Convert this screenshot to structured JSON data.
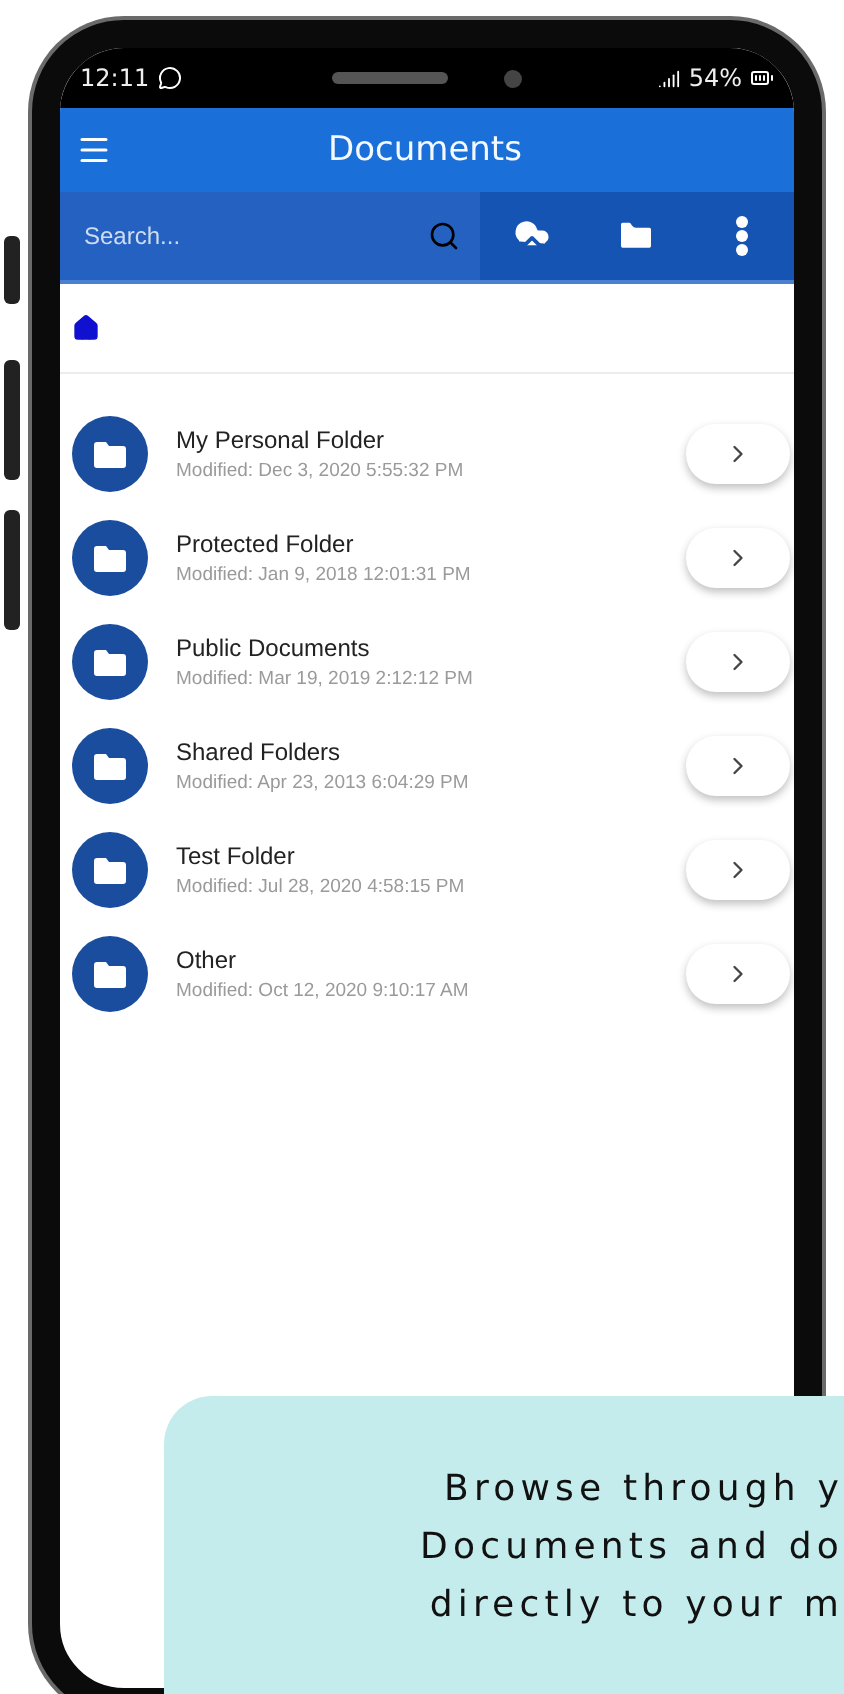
{
  "status_bar": {
    "time": "12:11",
    "battery": "54%"
  },
  "app_bar": {
    "title": "Documents"
  },
  "toolbar": {
    "search": {
      "placeholder": "Search..."
    }
  },
  "folders": [
    {
      "name": "My Personal Folder",
      "modified": "Modified: Dec 3, 2020 5:55:32 PM"
    },
    {
      "name": "Protected Folder",
      "modified": "Modified: Jan 9, 2018 12:01:31 PM"
    },
    {
      "name": "Public Documents",
      "modified": "Modified: Mar 19, 2019 2:12:12 PM"
    },
    {
      "name": "Shared Folders",
      "modified": "Modified: Apr 23, 2013 6:04:29 PM"
    },
    {
      "name": "Test Folder",
      "modified": "Modified: Jul 28, 2020 4:58:15 PM"
    },
    {
      "name": "Other",
      "modified": "Modified: Oct 12, 2020 9:10:17 AM"
    }
  ],
  "caption": {
    "lines": [
      "Browse through y",
      "Documents and do",
      "directly to your m"
    ]
  }
}
